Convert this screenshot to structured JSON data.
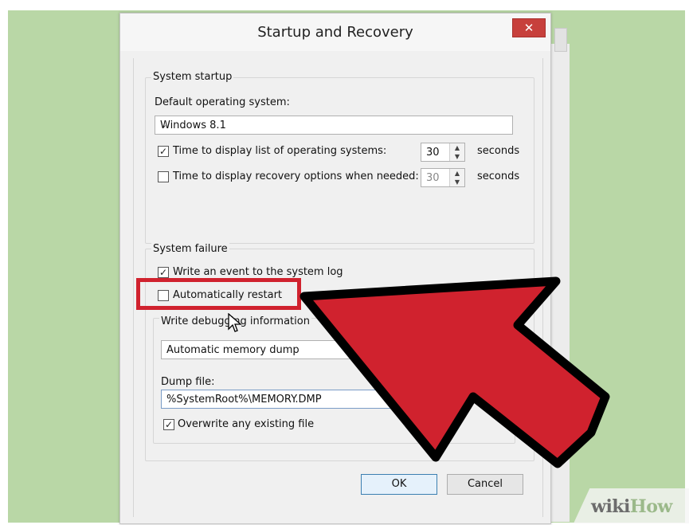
{
  "window": {
    "title": "Startup and Recovery",
    "close_glyph": "✕"
  },
  "system_startup": {
    "legend": "System startup",
    "default_os_label": "Default operating system:",
    "default_os_value": "Windows 8.1",
    "time_list_label": "Time to display list of operating systems:",
    "time_list_checked": true,
    "time_list_value": "30",
    "time_list_unit": "seconds",
    "time_recovery_label": "Time to display recovery options when needed:",
    "time_recovery_checked": false,
    "time_recovery_value": "30",
    "time_recovery_unit": "seconds"
  },
  "system_failure": {
    "legend": "System failure",
    "write_event_label": "Write an event to the system log",
    "write_event_checked": true,
    "auto_restart_label": "Automatically restart",
    "auto_restart_checked": false,
    "debug_info_label": "Write debugging information",
    "debug_info_value": "Automatic memory dump",
    "dump_file_label": "Dump file:",
    "dump_file_value": "%SystemRoot%\\MEMORY.DMP",
    "overwrite_label": "Overwrite any existing file",
    "overwrite_checked": true
  },
  "buttons": {
    "ok": "OK",
    "cancel": "Cancel"
  },
  "annotation": {
    "highlight_color": "#d0222e",
    "arrow_color": "#d0222e"
  },
  "watermark": {
    "part1": "wiki",
    "part2": "How"
  },
  "icons": {
    "checkmark": "✓",
    "chevron": "⌄",
    "spin_up": "▲",
    "spin_down": "▼"
  }
}
